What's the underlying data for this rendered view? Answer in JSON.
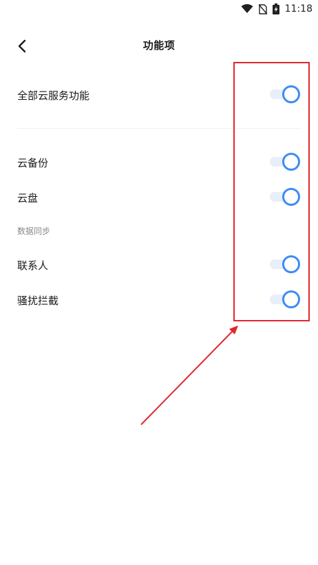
{
  "status_bar": {
    "time": "11:18",
    "icons": [
      "wifi-icon",
      "no-sim-icon",
      "battery-charging-icon"
    ]
  },
  "header": {
    "title": "功能项",
    "back_icon": "chevron-left-icon"
  },
  "settings": {
    "all_services": {
      "label": "全部云服务功能",
      "enabled": true
    },
    "cloud_backup": {
      "label": "云备份",
      "enabled": true
    },
    "cloud_drive": {
      "label": "云盘",
      "enabled": true
    },
    "sync_section_label": "数据同步",
    "contacts": {
      "label": "联系人",
      "enabled": true
    },
    "harassment_block": {
      "label": "骚扰拦截",
      "enabled": true
    }
  },
  "colors": {
    "accent": "#3d8bf2",
    "track": "#e7effb",
    "annotation": "#e0262b"
  }
}
